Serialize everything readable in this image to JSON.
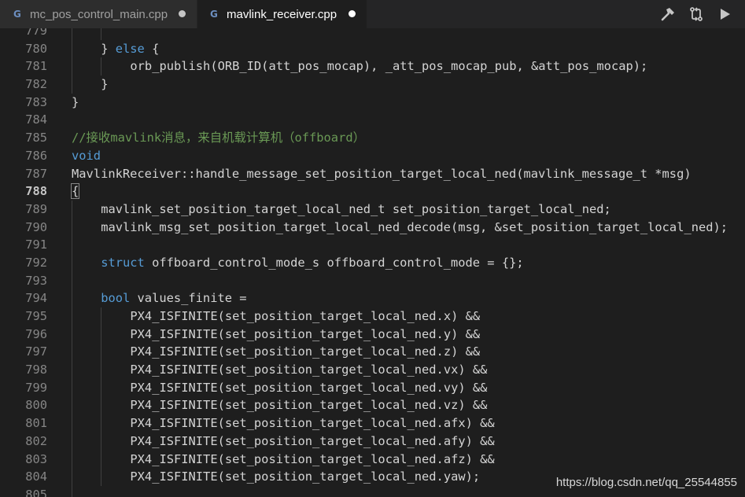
{
  "tabs": [
    {
      "label": "mc_pos_control_main.cpp",
      "icon": "cpp-file-icon",
      "dirty": true,
      "active": false
    },
    {
      "label": "mavlink_receiver.cpp",
      "icon": "cpp-file-icon",
      "dirty": true,
      "active": true
    }
  ],
  "tab_icon_glyph": "G",
  "toolbar": {
    "actions": [
      {
        "name": "build-hammer-icon"
      },
      {
        "name": "compare-changes-icon"
      },
      {
        "name": "run-play-icon"
      }
    ]
  },
  "editor": {
    "current_line": "788",
    "lines": [
      {
        "num": "779",
        "indent": 0,
        "guides": 2,
        "segments": []
      },
      {
        "num": "780",
        "indent": 1,
        "guides": 1,
        "segments": [
          {
            "t": "} ",
            "c": ""
          },
          {
            "t": "else",
            "c": "kw"
          },
          {
            "t": " {",
            "c": ""
          }
        ]
      },
      {
        "num": "781",
        "indent": 2,
        "guides": 2,
        "segments": [
          {
            "t": "orb_publish(ORB_ID(att_pos_mocap), _att_pos_mocap_pub, &att_pos_mocap);",
            "c": ""
          }
        ]
      },
      {
        "num": "782",
        "indent": 1,
        "guides": 1,
        "segments": [
          {
            "t": "}",
            "c": ""
          }
        ]
      },
      {
        "num": "783",
        "indent": 0,
        "guides": 0,
        "segments": [
          {
            "t": "}",
            "c": ""
          }
        ]
      },
      {
        "num": "784",
        "indent": 0,
        "guides": 0,
        "segments": []
      },
      {
        "num": "785",
        "indent": 0,
        "guides": 0,
        "segments": [
          {
            "t": "//接收mavlink消息，来自机载计算机（offboard）",
            "c": "cm"
          }
        ]
      },
      {
        "num": "786",
        "indent": 0,
        "guides": 0,
        "segments": [
          {
            "t": "void",
            "c": "kw"
          }
        ]
      },
      {
        "num": "787",
        "indent": 0,
        "guides": 0,
        "segments": [
          {
            "t": "MavlinkReceiver::handle_message_set_position_target_local_ned(mavlink_message_t *msg)",
            "c": ""
          }
        ]
      },
      {
        "num": "788",
        "indent": 0,
        "guides": 0,
        "segments": [
          {
            "t": "{",
            "c": "br"
          }
        ]
      },
      {
        "num": "789",
        "indent": 1,
        "guides": 1,
        "segments": [
          {
            "t": "mavlink_set_position_target_local_ned_t set_position_target_local_ned;",
            "c": ""
          }
        ]
      },
      {
        "num": "790",
        "indent": 1,
        "guides": 1,
        "segments": [
          {
            "t": "mavlink_msg_set_position_target_local_ned_decode(msg, &set_position_target_local_ned);",
            "c": ""
          }
        ]
      },
      {
        "num": "791",
        "indent": 0,
        "guides": 1,
        "segments": []
      },
      {
        "num": "792",
        "indent": 1,
        "guides": 1,
        "segments": [
          {
            "t": "struct",
            "c": "kw"
          },
          {
            "t": " offboard_control_mode_s offboard_control_mode = {};",
            "c": ""
          }
        ]
      },
      {
        "num": "793",
        "indent": 0,
        "guides": 1,
        "segments": []
      },
      {
        "num": "794",
        "indent": 1,
        "guides": 1,
        "segments": [
          {
            "t": "bool",
            "c": "kw"
          },
          {
            "t": " values_finite =",
            "c": ""
          }
        ]
      },
      {
        "num": "795",
        "indent": 2,
        "guides": 2,
        "segments": [
          {
            "t": "PX4_ISFINITE(set_position_target_local_ned.x) &&",
            "c": ""
          }
        ]
      },
      {
        "num": "796",
        "indent": 2,
        "guides": 2,
        "segments": [
          {
            "t": "PX4_ISFINITE(set_position_target_local_ned.y) &&",
            "c": ""
          }
        ]
      },
      {
        "num": "797",
        "indent": 2,
        "guides": 2,
        "segments": [
          {
            "t": "PX4_ISFINITE(set_position_target_local_ned.z) &&",
            "c": ""
          }
        ]
      },
      {
        "num": "798",
        "indent": 2,
        "guides": 2,
        "segments": [
          {
            "t": "PX4_ISFINITE(set_position_target_local_ned.vx) &&",
            "c": ""
          }
        ]
      },
      {
        "num": "799",
        "indent": 2,
        "guides": 2,
        "segments": [
          {
            "t": "PX4_ISFINITE(set_position_target_local_ned.vy) &&",
            "c": ""
          }
        ]
      },
      {
        "num": "800",
        "indent": 2,
        "guides": 2,
        "segments": [
          {
            "t": "PX4_ISFINITE(set_position_target_local_ned.vz) &&",
            "c": ""
          }
        ]
      },
      {
        "num": "801",
        "indent": 2,
        "guides": 2,
        "segments": [
          {
            "t": "PX4_ISFINITE(set_position_target_local_ned.afx) &&",
            "c": ""
          }
        ]
      },
      {
        "num": "802",
        "indent": 2,
        "guides": 2,
        "segments": [
          {
            "t": "PX4_ISFINITE(set_position_target_local_ned.afy) &&",
            "c": ""
          }
        ]
      },
      {
        "num": "803",
        "indent": 2,
        "guides": 2,
        "segments": [
          {
            "t": "PX4_ISFINITE(set_position_target_local_ned.afz) &&",
            "c": ""
          }
        ]
      },
      {
        "num": "804",
        "indent": 2,
        "guides": 2,
        "segments": [
          {
            "t": "PX4_ISFINITE(set_position_target_local_ned.yaw);",
            "c": ""
          }
        ]
      },
      {
        "num": "805",
        "indent": 0,
        "guides": 1,
        "segments": []
      }
    ]
  },
  "watermark": "https://blog.csdn.net/qq_25544855",
  "colors": {
    "background": "#1e1e1e",
    "keyword": "#569cd6",
    "comment": "#6a9955",
    "text": "#d4d4d4",
    "line_number": "#858585"
  }
}
